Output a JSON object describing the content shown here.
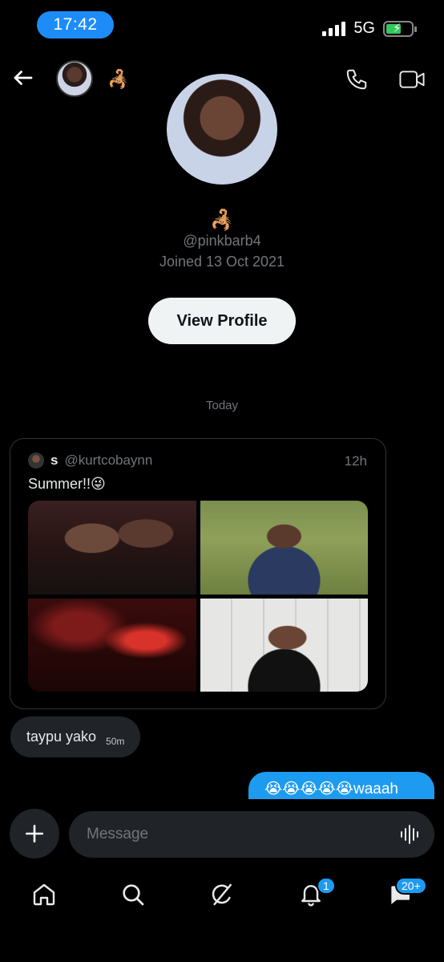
{
  "status_bar": {
    "time": "17:42",
    "network": "5G"
  },
  "header": {
    "emoji": "🦂",
    "icons": {
      "back": "arrow-left-icon",
      "call": "phone-icon",
      "video": "video-camera-icon"
    }
  },
  "profile": {
    "emoji": "🦂",
    "handle": "@pinkbarb4",
    "joined": "Joined 13 Oct 2021",
    "view_profile_label": "View Profile"
  },
  "conversation": {
    "date_separator": "Today",
    "shared_post": {
      "author_name": "s",
      "author_handle": "@kurtcobaynn",
      "time": "12h",
      "text": "Summer!!😜"
    },
    "messages": [
      {
        "text": "taypu yako",
        "time": "50m",
        "direction": "incoming"
      },
      {
        "text": "😭😭😭😭😭waaah",
        "direction": "outgoing"
      }
    ]
  },
  "composer": {
    "placeholder": "Message"
  },
  "tab_bar": {
    "items": [
      {
        "icon": "home-icon"
      },
      {
        "icon": "search-icon"
      },
      {
        "icon": "grok-icon"
      },
      {
        "icon": "bell-icon",
        "badge": "1"
      },
      {
        "icon": "messages-icon",
        "badge": "20+"
      }
    ]
  },
  "colors": {
    "accent": "#1d9bf0",
    "time_pill": "#1d8cf8",
    "bubble_incoming": "#202327",
    "battery": "#34c759"
  }
}
